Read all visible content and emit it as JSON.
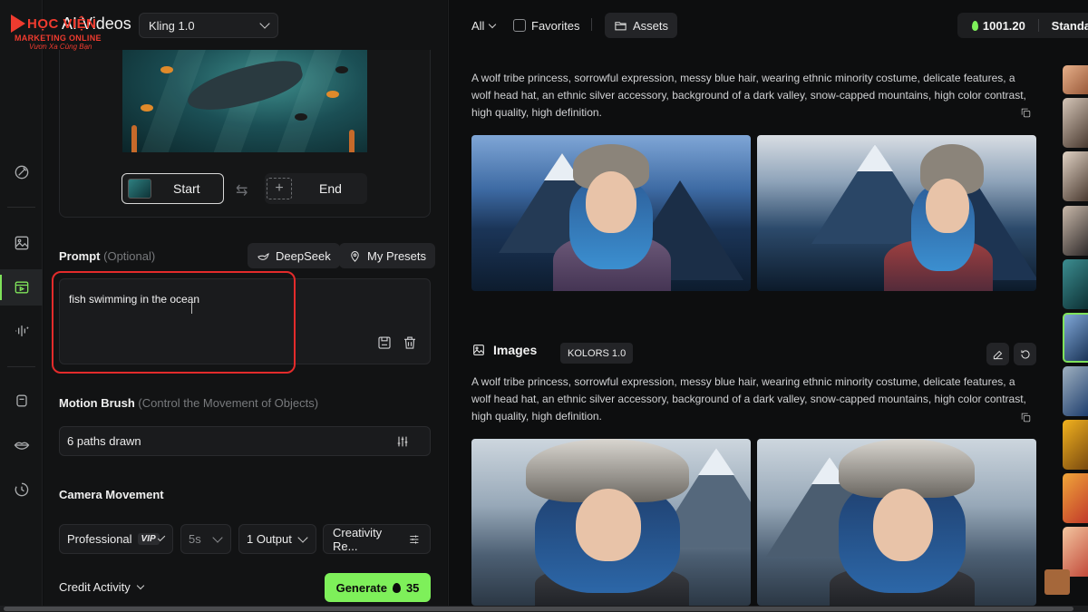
{
  "logo": {
    "brand_line1": "HỌC VIỆN",
    "brand_line2": "MARKETING ONLINE",
    "brand_line3": "Vươn Xa Cùng Bạn"
  },
  "panel": {
    "title": "AI Videos",
    "model_select": "Kling 1.0",
    "frames": {
      "start_label": "Start",
      "end_label": "End"
    },
    "prompt": {
      "label": "Prompt",
      "sublabel": "(Optional)",
      "deepseek_label": "DeepSeek",
      "presets_label": "My Presets",
      "value": "fish swimming in the ocean"
    },
    "motion_brush": {
      "label": "Motion Brush",
      "sublabel": "(Control the Movement of Objects)",
      "value": "6 paths drawn"
    },
    "camera": {
      "label": "Camera Movement"
    },
    "options": {
      "mode": "Professional",
      "vip_badge": "VIP",
      "duration": "5s",
      "outputs": "1 Output",
      "creativity": "Creativity Re..."
    },
    "credit_activity": "Credit Activity",
    "generate_label": "Generate",
    "generate_cost": "35"
  },
  "toolbar": {
    "filter": "All",
    "favorites": "Favorites",
    "assets": "Assets",
    "credits": "1001.20",
    "plan": "Standard"
  },
  "feed": {
    "block1_prompt": "A wolf tribe princess, sorrowful expression, messy blue hair, wearing ethnic minority costume, delicate features, a wolf head hat, an ethnic silver accessory, background of a dark valley, snow-capped mountains, high color contrast, high quality, high definition.",
    "images_title": "Images",
    "images_model": "KOLORS 1.0",
    "block2_prompt": "A wolf tribe princess, sorrowful expression, messy blue hair, wearing ethnic minority costume, delicate features, a wolf head hat, an ethnic silver accessory, background of a dark valley, snow-capped mountains, high color contrast, high quality, high definition."
  },
  "colors": {
    "accent": "#7ef05a",
    "highlight": "#e32b2b"
  },
  "icons": [
    "menu-icon",
    "magic-icon",
    "image-icon",
    "video-icon",
    "audio-icon",
    "robot-icon",
    "lips-icon",
    "history-icon",
    "settings-sliders-icon",
    "save-icon",
    "trash-icon",
    "folder-icon",
    "copy-icon",
    "edit-icon",
    "refresh-icon"
  ]
}
